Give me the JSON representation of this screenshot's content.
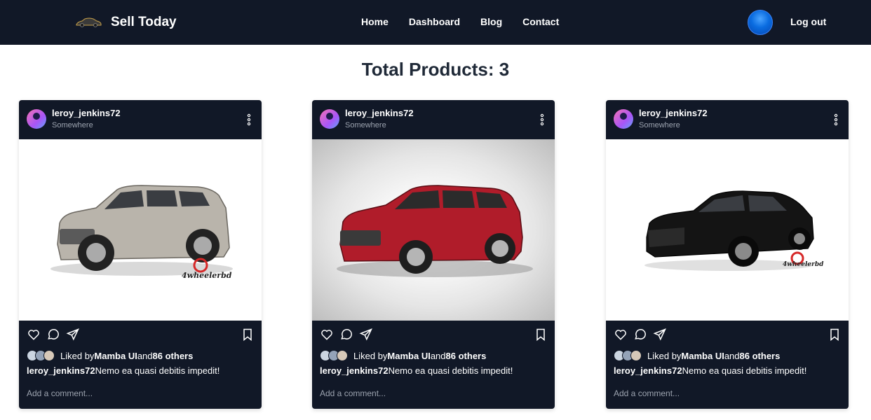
{
  "navbar": {
    "brand": "Sell Today",
    "links": [
      "Home",
      "Dashboard",
      "Blog",
      "Contact"
    ],
    "logout": "Log out"
  },
  "page": {
    "total": "Total Products: 3"
  },
  "cards": [
    {
      "username": "leroy_jenkins72",
      "location": "Somewhere",
      "liked_prefix": "Liked by",
      "liked_user": "Mamba UI",
      "liked_and": "and",
      "liked_others": "86 others",
      "caption_user": "leroy_jenkins72",
      "caption_text": "Nemo ea quasi debitis impedit!",
      "comment_placeholder": "Add a comment...",
      "watermark": "4wheelerbd",
      "car_color": "#b9b4ab"
    },
    {
      "username": "leroy_jenkins72",
      "location": "Somewhere",
      "liked_prefix": "Liked by",
      "liked_user": "Mamba UI",
      "liked_and": "and",
      "liked_others": "86 others",
      "caption_user": "leroy_jenkins72",
      "caption_text": "Nemo ea quasi debitis impedit!",
      "comment_placeholder": "Add a comment...",
      "watermark": "",
      "car_color": "#b01c2a"
    },
    {
      "username": "leroy_jenkins72",
      "location": "Somewhere",
      "liked_prefix": "Liked by",
      "liked_user": "Mamba UI",
      "liked_and": "and",
      "liked_others": "86 others",
      "caption_user": "leroy_jenkins72",
      "caption_text": "Nemo ea quasi debitis impedit!",
      "comment_placeholder": "Add a comment...",
      "watermark": "4wheelerbd",
      "car_color": "#141414"
    }
  ],
  "colors": {
    "nav_bg": "#111827",
    "card_bg": "#111827",
    "muted": "#9ca3af",
    "heading": "#1f2937"
  },
  "icons": [
    "car-logo-icon",
    "more-vertical-icon",
    "heart-icon",
    "comment-icon",
    "share-icon",
    "bookmark-icon"
  ]
}
